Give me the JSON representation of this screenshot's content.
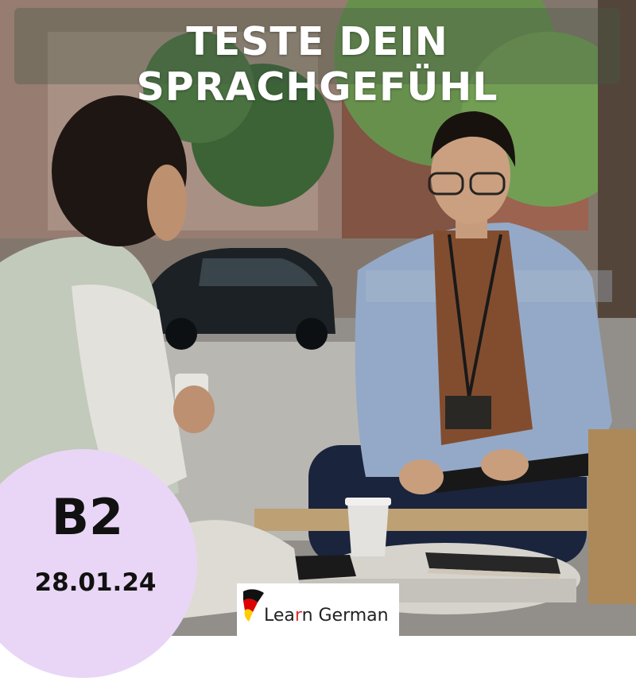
{
  "title": "TESTE DEIN SPRACHGEFÜHL",
  "badge": {
    "level": "B2",
    "date": "28.01.24",
    "color": "#e9d6f6"
  },
  "logo": {
    "text_before": "Lea",
    "text_accent": "r",
    "text_after": "n German",
    "icon": "germany-flag-speech-bubble-icon"
  },
  "colors": {
    "title_text": "#ffffff",
    "accent_red": "#d9342b",
    "flag_black": "#111111",
    "flag_red": "#dd0000",
    "flag_gold": "#ffce00"
  }
}
